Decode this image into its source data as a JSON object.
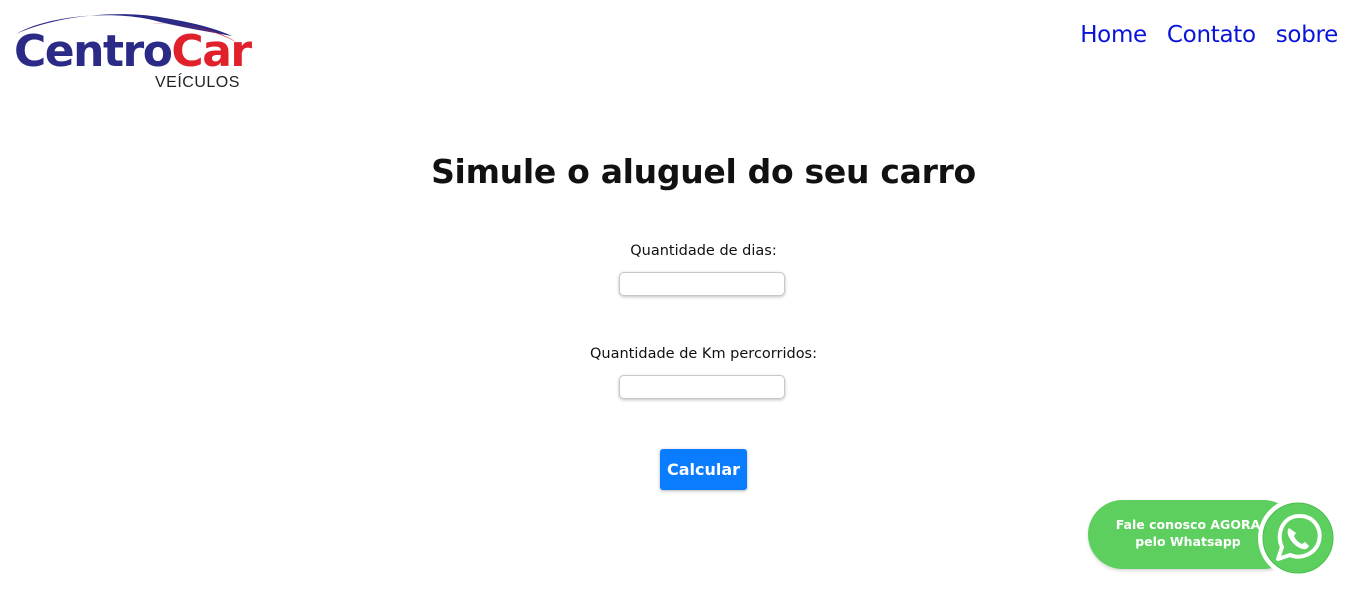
{
  "logo": {
    "brand_part1": "Centro",
    "brand_part2": "Car",
    "subtitle": "VEÍCULOS",
    "colors": {
      "blue": "#2b2a86",
      "red": "#e0202a"
    }
  },
  "nav": {
    "items": [
      {
        "label": "Home"
      },
      {
        "label": "Contato"
      },
      {
        "label": "sobre"
      }
    ],
    "color": "#0a14d9"
  },
  "main": {
    "title": "Simule o aluguel do seu carro",
    "days_label": "Quantidade de dias:",
    "days_value": "",
    "km_label": "Quantidade de Km percorridos:",
    "km_value": "",
    "calculate_label": "Calcular",
    "button_color": "#0a7cff"
  },
  "whatsapp": {
    "line1": "Fale conosco AGORA",
    "line2": "pelo Whatsapp",
    "icon": "whatsapp-icon",
    "color": "#5dcf5f"
  }
}
